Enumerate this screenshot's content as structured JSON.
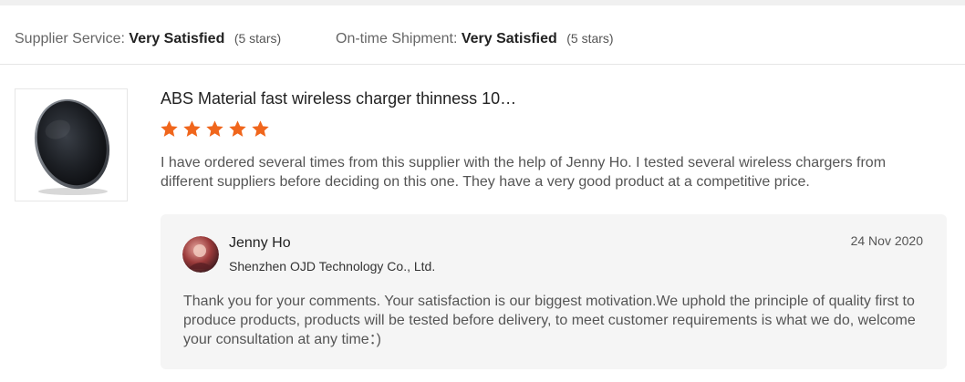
{
  "ratings": [
    {
      "label": "Supplier Service:",
      "value": "Very Satisfied",
      "stars_text": "(5 stars)"
    },
    {
      "label": "On-time Shipment:",
      "value": "Very Satisfied",
      "stars_text": "(5 stars)"
    }
  ],
  "review": {
    "product_image_icon": "wireless-charger-image",
    "product_title": "ABS Material fast wireless charger thinness 10…",
    "star_rating": 5,
    "star_color": "#f0661c",
    "text": "I have ordered several times from this supplier with the help of Jenny Ho. I tested several wireless chargers from different suppliers before deciding on this one. They have a very good product at a competitive price."
  },
  "reply": {
    "avatar_icon": "user-avatar",
    "name": "Jenny Ho",
    "company": "Shenzhen OJD Technology Co., Ltd.",
    "date": "24 Nov 2020",
    "text": "Thank you for your comments. Your satisfaction is our biggest motivation.We uphold the principle of quality first to produce products, products will be tested before delivery, to meet customer requirements is what we do, welcome your consultation at any time：)"
  }
}
